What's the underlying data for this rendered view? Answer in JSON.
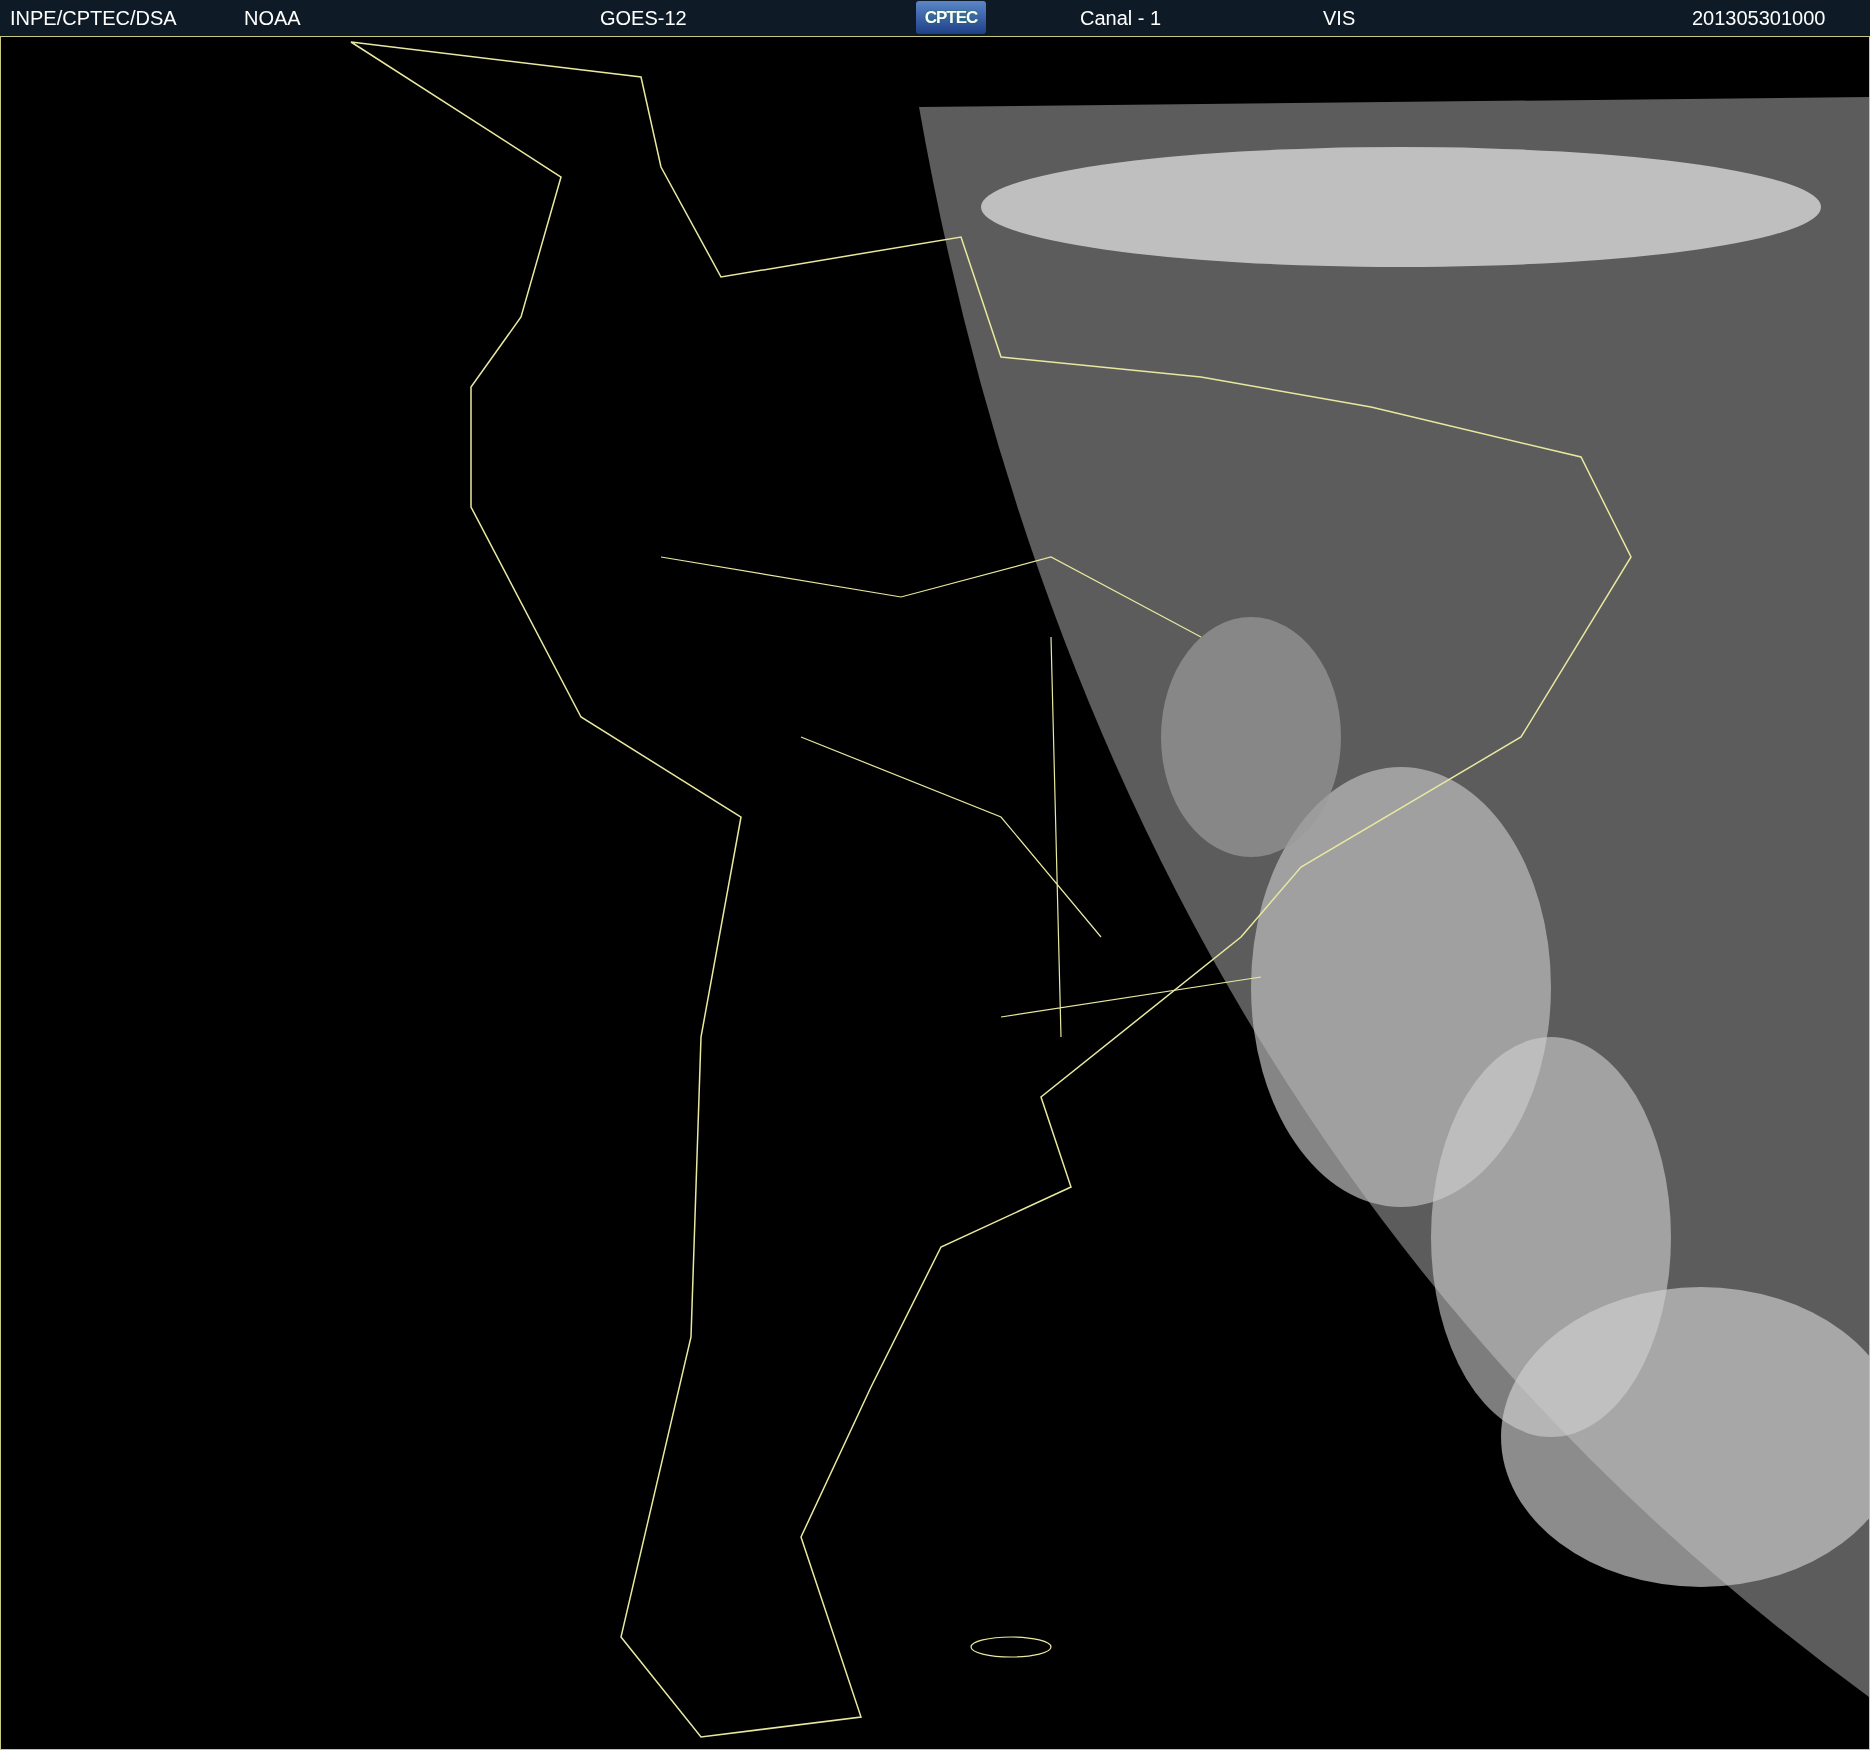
{
  "header": {
    "items": [
      {
        "text": "INPE/CPTEC/DSA",
        "kind": "text"
      },
      {
        "text": "NOAA",
        "kind": "text"
      },
      {
        "text": "GOES-12",
        "kind": "text"
      },
      {
        "text": "CPTEC",
        "kind": "logo"
      },
      {
        "text": "Canal - 1",
        "kind": "text"
      },
      {
        "text": "VIS",
        "kind": "text"
      },
      {
        "text": "201305301000",
        "kind": "text"
      }
    ]
  }
}
